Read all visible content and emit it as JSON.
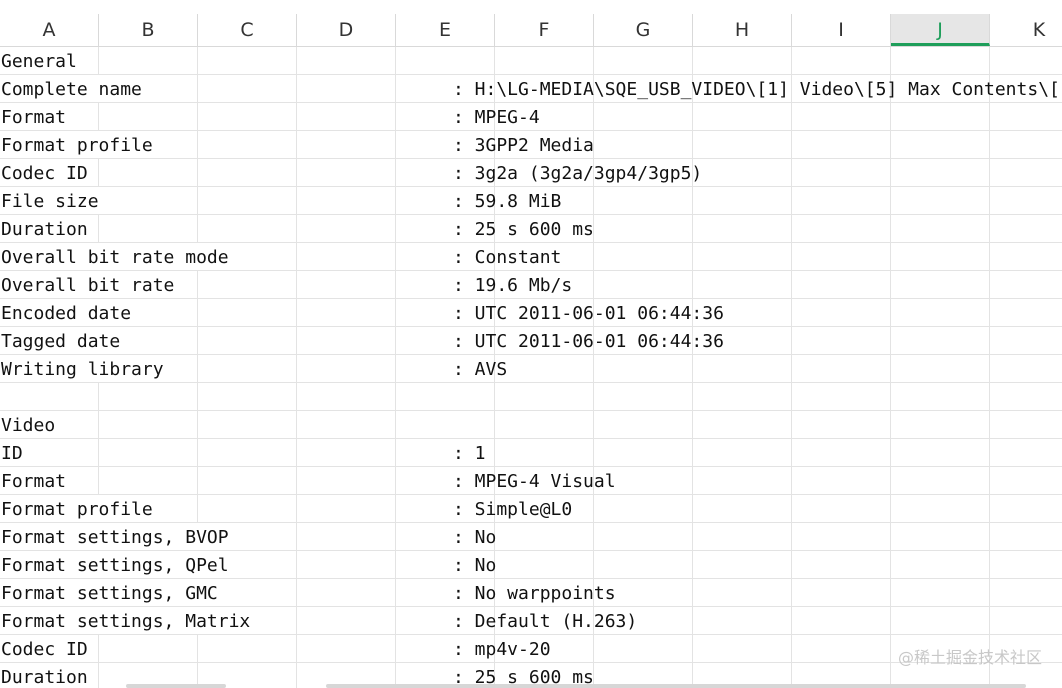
{
  "columns": [
    "A",
    "B",
    "C",
    "D",
    "E",
    "F",
    "G",
    "H",
    "I",
    "J",
    "K"
  ],
  "selected_column": "J",
  "accent_color": "#1e9e5a",
  "rows": [
    {
      "label": "General",
      "value": ""
    },
    {
      "label": "Complete name",
      "value": ": H:\\LG-MEDIA\\SQE_USB_VIDEO\\[1] Video\\[5] Max Contents\\["
    },
    {
      "label": "Format",
      "value": ": MPEG-4"
    },
    {
      "label": "Format profile",
      "value": ": 3GPP2 Media"
    },
    {
      "label": "Codec ID",
      "value": ": 3g2a (3g2a/3gp4/3gp5)"
    },
    {
      "label": "File size",
      "value": ": 59.8 MiB"
    },
    {
      "label": "Duration",
      "value": ": 25 s 600 ms"
    },
    {
      "label": "Overall bit rate mode",
      "value": ": Constant"
    },
    {
      "label": "Overall bit rate",
      "value": ": 19.6 Mb/s"
    },
    {
      "label": "Encoded date",
      "value": ": UTC 2011-06-01 06:44:36"
    },
    {
      "label": "Tagged date",
      "value": ": UTC 2011-06-01 06:44:36"
    },
    {
      "label": "Writing library",
      "value": ": AVS"
    },
    {
      "label": "",
      "value": ""
    },
    {
      "label": "Video",
      "value": ""
    },
    {
      "label": "ID",
      "value": ": 1"
    },
    {
      "label": "Format",
      "value": ": MPEG-4 Visual"
    },
    {
      "label": "Format profile",
      "value": ": Simple@L0"
    },
    {
      "label": "Format settings, BVOP",
      "value": ": No"
    },
    {
      "label": "Format settings, QPel",
      "value": ": No"
    },
    {
      "label": "Format settings, GMC",
      "value": ": No warppoints"
    },
    {
      "label": "Format settings, Matrix",
      "value": ": Default (H.263)"
    },
    {
      "label": "Codec ID",
      "value": ": mp4v-20"
    },
    {
      "label": "Duration",
      "value": ": 25 s 600 ms"
    }
  ],
  "watermark": "@稀土掘金技术社区"
}
